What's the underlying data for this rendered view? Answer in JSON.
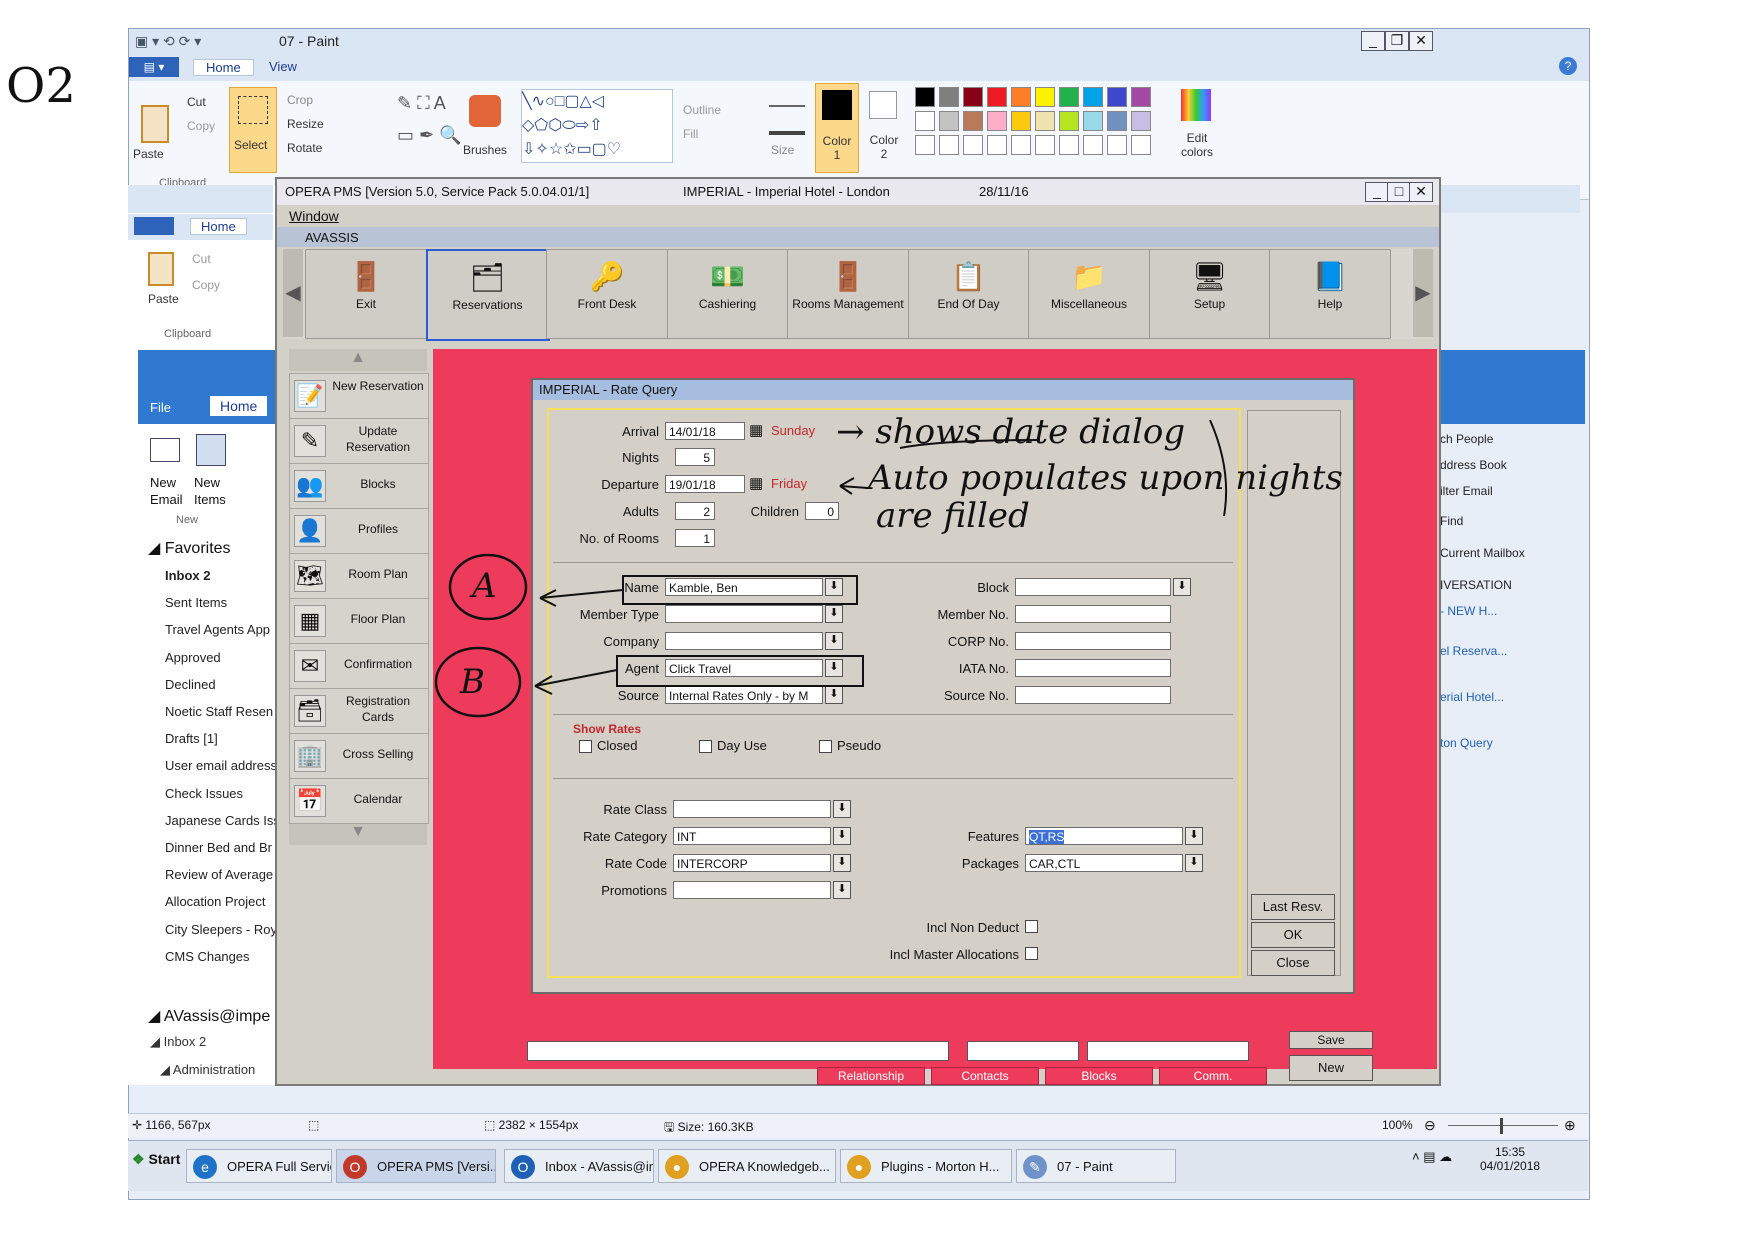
{
  "annotations": {
    "page_mark": "O2",
    "show_date": "→ shows date dialog",
    "auto_populate_1": "Auto populates upon nights",
    "auto_populate_2": "are filled",
    "circle_a": "A",
    "circle_b": "B"
  },
  "paint": {
    "title": "07 - Paint",
    "tabs": [
      "Home",
      "View"
    ],
    "clipboard": {
      "paste": "Paste",
      "cut": "Cut",
      "copy": "Copy",
      "group": "Clipboard"
    },
    "image": {
      "select": "Select",
      "crop": "Crop",
      "resize": "Resize",
      "rotate": "Rotate"
    },
    "brushes": "Brushes",
    "shapes": {
      "outline": "Outline",
      "fill": "Fill"
    },
    "size": "Size",
    "color1": "Color 1",
    "color2": "Color 2",
    "edit_colors": "Edit colors",
    "palette": [
      "#000000",
      "#7f7f7f",
      "#880015",
      "#ed1c24",
      "#ff7f27",
      "#fff200",
      "#22b14c",
      "#00a2e8",
      "#3f48cc",
      "#a349a4",
      "#ffffff",
      "#c3c3c3",
      "#b97a57",
      "#ffaec9",
      "#ffc90e",
      "#efe4b0",
      "#b5e61d",
      "#99d9ea",
      "#7092be",
      "#c8bfe7"
    ],
    "status": {
      "cursor": "1166, 567px",
      "dimensions": "2382 × 1554px",
      "size": "Size: 160.3KB",
      "zoom": "100%"
    }
  },
  "outlook": {
    "clipboard": {
      "paste": "Paste",
      "cut": "Cut",
      "copy": "Copy",
      "group": "Clipboard"
    },
    "tabs": {
      "file": "File",
      "home": "Home"
    },
    "new_email": "New Email",
    "new_items": "New Items",
    "new_group": "New",
    "favorites": "Favorites",
    "folders": [
      "Inbox 2",
      "Sent Items",
      "Travel Agents App",
      "Approved",
      "Declined",
      "Noetic Staff Resen",
      "Drafts [1]",
      "User email address",
      "Check Issues",
      "Japanese Cards Iss",
      "Dinner Bed and Br",
      "Review of Average",
      "Allocation Project",
      "City Sleepers - Roy",
      "CMS Changes"
    ],
    "account": "AVassis@impe",
    "inbox2": "Inbox 2",
    "administration": "Administration",
    "right_items": [
      "ch People",
      "ddress Book",
      "ilter Email",
      "Find",
      "Current Mailbox",
      "IVERSATION",
      "- NEW H...",
      "el Reserva...",
      "erial Hotel...",
      "ton Query"
    ]
  },
  "opera": {
    "title": "OPERA PMS [Version 5.0, Service Pack 5.0.04.01/1]",
    "hotel": "IMPERIAL - Imperial Hotel - London",
    "date": "28/11/16",
    "menu": "Window",
    "user": "AVASSIS",
    "toolbar": [
      {
        "label": "Exit",
        "icon": "exit-icon",
        "glyph": "🚪"
      },
      {
        "label": "Reservations",
        "icon": "reservations-icon",
        "glyph": "🗂"
      },
      {
        "label": "Front Desk",
        "icon": "front-desk-icon",
        "glyph": "🔑"
      },
      {
        "label": "Cashiering",
        "icon": "cashiering-icon",
        "glyph": "💵"
      },
      {
        "label": "Rooms Management",
        "icon": "rooms-management-icon",
        "glyph": "🚪"
      },
      {
        "label": "End Of Day",
        "icon": "end-of-day-icon",
        "glyph": "📋"
      },
      {
        "label": "Miscellaneous",
        "icon": "miscellaneous-icon",
        "glyph": "📁"
      },
      {
        "label": "Setup",
        "icon": "setup-icon",
        "glyph": "🖥"
      },
      {
        "label": "Help",
        "icon": "help-icon",
        "glyph": "📘"
      }
    ],
    "side": [
      {
        "label": "New Reservation",
        "icon": "new-reservation-icon",
        "glyph": "📝"
      },
      {
        "label": "Update Reservation",
        "icon": "update-reservation-icon",
        "glyph": "✎"
      },
      {
        "label": "Blocks",
        "icon": "blocks-icon",
        "glyph": "👥"
      },
      {
        "label": "Profiles",
        "icon": "profiles-icon",
        "glyph": "👤"
      },
      {
        "label": "Room Plan",
        "icon": "room-plan-icon",
        "glyph": "🗺"
      },
      {
        "label": "Floor Plan",
        "icon": "floor-plan-icon",
        "glyph": "▦"
      },
      {
        "label": "Confirmation",
        "icon": "confirmation-icon",
        "glyph": "✉"
      },
      {
        "label": "Registration Cards",
        "icon": "registration-cards-icon",
        "glyph": "🗃"
      },
      {
        "label": "Cross Selling",
        "icon": "cross-selling-icon",
        "glyph": "🏢"
      },
      {
        "label": "Calendar",
        "icon": "calendar-icon",
        "glyph": "📅"
      }
    ],
    "bottom_tabs": [
      "Relationship",
      "Contacts",
      "Blocks",
      "Comm."
    ],
    "bottom_buttons": {
      "save": "Save",
      "new": "New"
    }
  },
  "rate_query": {
    "title": "IMPERIAL - Rate Query",
    "arrival": {
      "label": "Arrival",
      "value": "14/01/18",
      "day": "Sunday"
    },
    "nights": {
      "label": "Nights",
      "value": "5"
    },
    "departure": {
      "label": "Departure",
      "value": "19/01/18",
      "day": "Friday"
    },
    "adults": {
      "label": "Adults",
      "value": "2"
    },
    "children": {
      "label": "Children",
      "value": "0"
    },
    "rooms": {
      "label": "No. of Rooms",
      "value": "1"
    },
    "name": {
      "label": "Name",
      "value": "Kamble, Ben"
    },
    "member_type": {
      "label": "Member Type",
      "value": ""
    },
    "company": {
      "label": "Company",
      "value": ""
    },
    "agent": {
      "label": "Agent",
      "value": "Click Travel"
    },
    "source": {
      "label": "Source",
      "value": "Internal Rates Only - by M"
    },
    "block": {
      "label": "Block",
      "value": ""
    },
    "member_no": {
      "label": "Member No.",
      "value": ""
    },
    "corp_no": {
      "label": "CORP No.",
      "value": ""
    },
    "iata_no": {
      "label": "IATA No.",
      "value": ""
    },
    "source_no": {
      "label": "Source No.",
      "value": ""
    },
    "show_rates": "Show Rates",
    "closed": "Closed",
    "day_use": "Day Use",
    "pseudo": "Pseudo",
    "rate_class": {
      "label": "Rate Class",
      "value": ""
    },
    "rate_category": {
      "label": "Rate Category",
      "value": "INT"
    },
    "rate_code": {
      "label": "Rate Code",
      "value": "INTERCORP"
    },
    "promotions": {
      "label": "Promotions",
      "value": ""
    },
    "features": {
      "label": "Features",
      "value": "QT,RS"
    },
    "packages": {
      "label": "Packages",
      "value": "CAR,CTL"
    },
    "incl_non_deduct": "Incl Non Deduct",
    "incl_master": "Incl Master Allocations",
    "buttons": {
      "last_resv": "Last Resv.",
      "ok": "OK",
      "close": "Close"
    }
  },
  "taskbar": {
    "start": "Start",
    "items": [
      {
        "label": "OPERA Full Service ...",
        "color": "#1e73c8",
        "glyph": "e"
      },
      {
        "label": "OPERA PMS [Versi...",
        "color": "#c0392b",
        "glyph": "O"
      },
      {
        "label": "Inbox - AVassis@im...",
        "color": "#1f5fb5",
        "glyph": "O"
      },
      {
        "label": "OPERA Knowledgeb...",
        "color": "#e0a020",
        "glyph": "●"
      },
      {
        "label": "Plugins - Morton H...",
        "color": "#e0a020",
        "glyph": "●"
      },
      {
        "label": "07 - Paint",
        "color": "#6f93c8",
        "glyph": "✎"
      }
    ],
    "time": "15:35",
    "date": "04/01/2018"
  }
}
